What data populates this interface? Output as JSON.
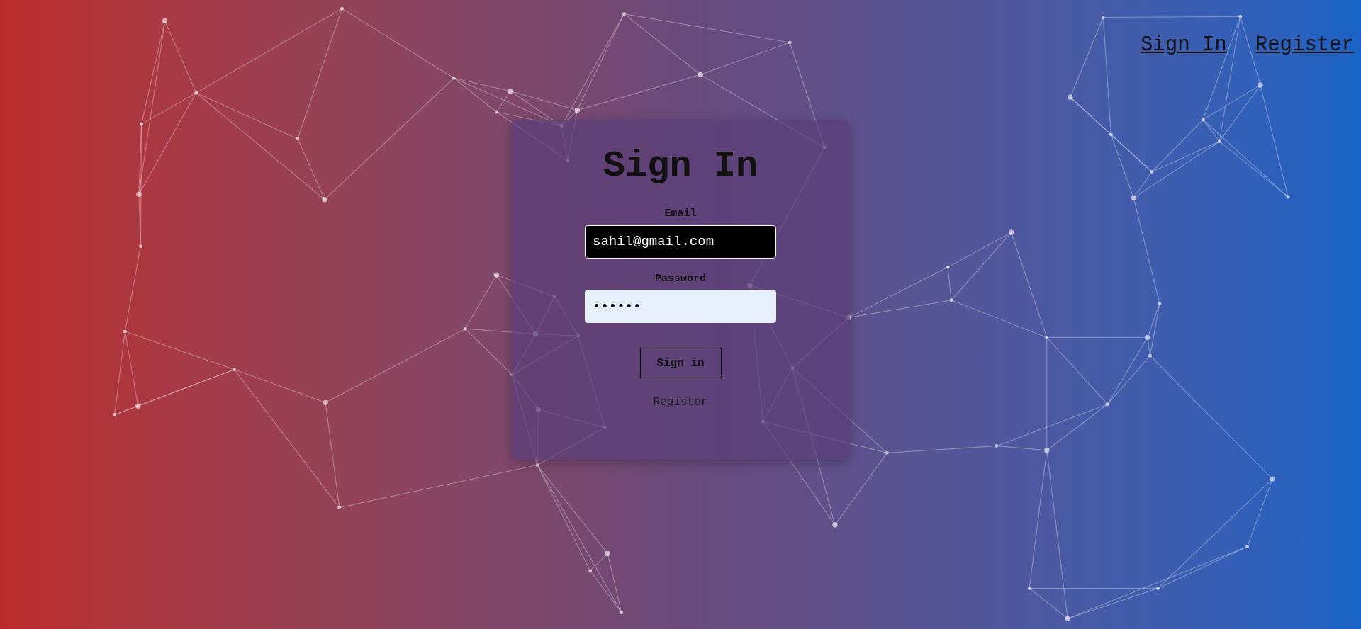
{
  "nav": {
    "links": [
      {
        "label": "Sign In"
      },
      {
        "label": "Register"
      }
    ]
  },
  "form": {
    "title": "Sign In",
    "fields": [
      {
        "label": "Email",
        "kind": "text",
        "value": "sahil@gmail.com"
      },
      {
        "label": "Password",
        "kind": "password",
        "value": "••••••"
      }
    ],
    "submit": "Sign in",
    "link": "Register"
  }
}
